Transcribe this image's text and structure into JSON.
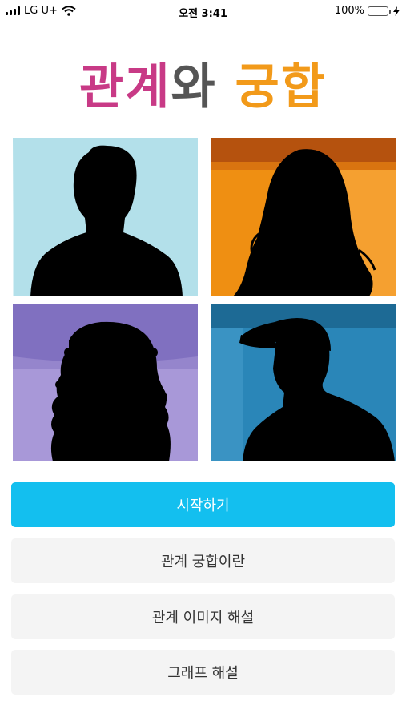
{
  "status_bar": {
    "carrier": "LG U+",
    "time": "오전 3:41",
    "battery_percent": "100%",
    "battery_level": 1.0,
    "icons": [
      "signal-icon",
      "wifi-icon",
      "battery-icon",
      "charging-icon"
    ]
  },
  "title": {
    "part1": "관계",
    "part2": "와",
    "part3": "궁합"
  },
  "colors": {
    "title_pink": "#c83a86",
    "title_gray": "#555555",
    "title_orange": "#f29a1a",
    "primary_button": "#13bfef",
    "secondary_button": "#f4f4f4"
  },
  "images": [
    {
      "name": "male-silhouette",
      "background": "#b3e0ea"
    },
    {
      "name": "long-hair-female-silhouette",
      "background": "#ef8f12"
    },
    {
      "name": "curly-hair-silhouette",
      "background": "#a898d8"
    },
    {
      "name": "cap-silhouette",
      "background": "#2a86b8"
    }
  ],
  "buttons": {
    "start": "시작하기",
    "about_compat": "관계 궁합이란",
    "image_explain": "관계 이미지 해설",
    "graph_explain": "그래프 해설"
  }
}
